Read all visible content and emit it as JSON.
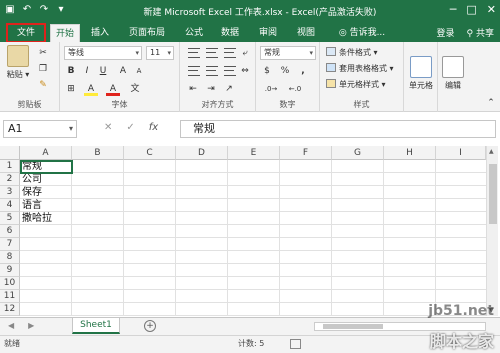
{
  "window": {
    "title": "新建 Microsoft Excel 工作表.xlsx - Excel(产品激活失败)",
    "controls": [
      "─",
      "□",
      "✕"
    ]
  },
  "tabs": {
    "file": "文件",
    "items": [
      "开始",
      "插入",
      "页面布局",
      "公式",
      "数据",
      "审阅",
      "视图"
    ],
    "active": "开始",
    "tell_me": "告诉我...",
    "login": "登录",
    "share": "共享"
  },
  "ribbon": {
    "clipboard": {
      "paste": "粘贴",
      "label": "剪贴板"
    },
    "font": {
      "name": "等线",
      "size": "11",
      "label": "字体",
      "bold": "B",
      "italic": "I",
      "underline": "U",
      "font_color": "A",
      "highlight": "A",
      "grow": "A",
      "shrink": "A"
    },
    "alignment": {
      "label": "对齐方式"
    },
    "number": {
      "format": "常规",
      "label": "数字",
      "percent": "%",
      "comma": ",",
      "currency": "$"
    },
    "styles": {
      "conditional": "条件格式 ▾",
      "table": "套用表格格式 ▾",
      "cell": "单元格样式 ▾",
      "label": "样式"
    },
    "cells": {
      "label": "单元格"
    },
    "editing": {
      "label": "编辑"
    }
  },
  "formula_bar": {
    "name_box": "A1",
    "cancel": "✕",
    "enter": "✓",
    "fx": "fx",
    "content": "常规"
  },
  "grid": {
    "columns": [
      "A",
      "B",
      "C",
      "D",
      "E",
      "F",
      "G",
      "H",
      "I"
    ],
    "rows": [
      "1",
      "2",
      "3",
      "4",
      "5",
      "6",
      "7",
      "8",
      "9",
      "10",
      "11",
      "12"
    ],
    "cells": [
      "常规",
      "公司",
      "保存",
      "语言",
      "撒哈拉"
    ]
  },
  "sheets": {
    "tabs": [
      "Sheet1"
    ],
    "add": "+"
  },
  "status": {
    "ready": "就绪",
    "count": "计数: 5"
  },
  "watermarks": [
    "jb51.net",
    "脚本之家"
  ],
  "colors": {
    "accent": "#217346",
    "highlight_box": "#e0231c"
  }
}
